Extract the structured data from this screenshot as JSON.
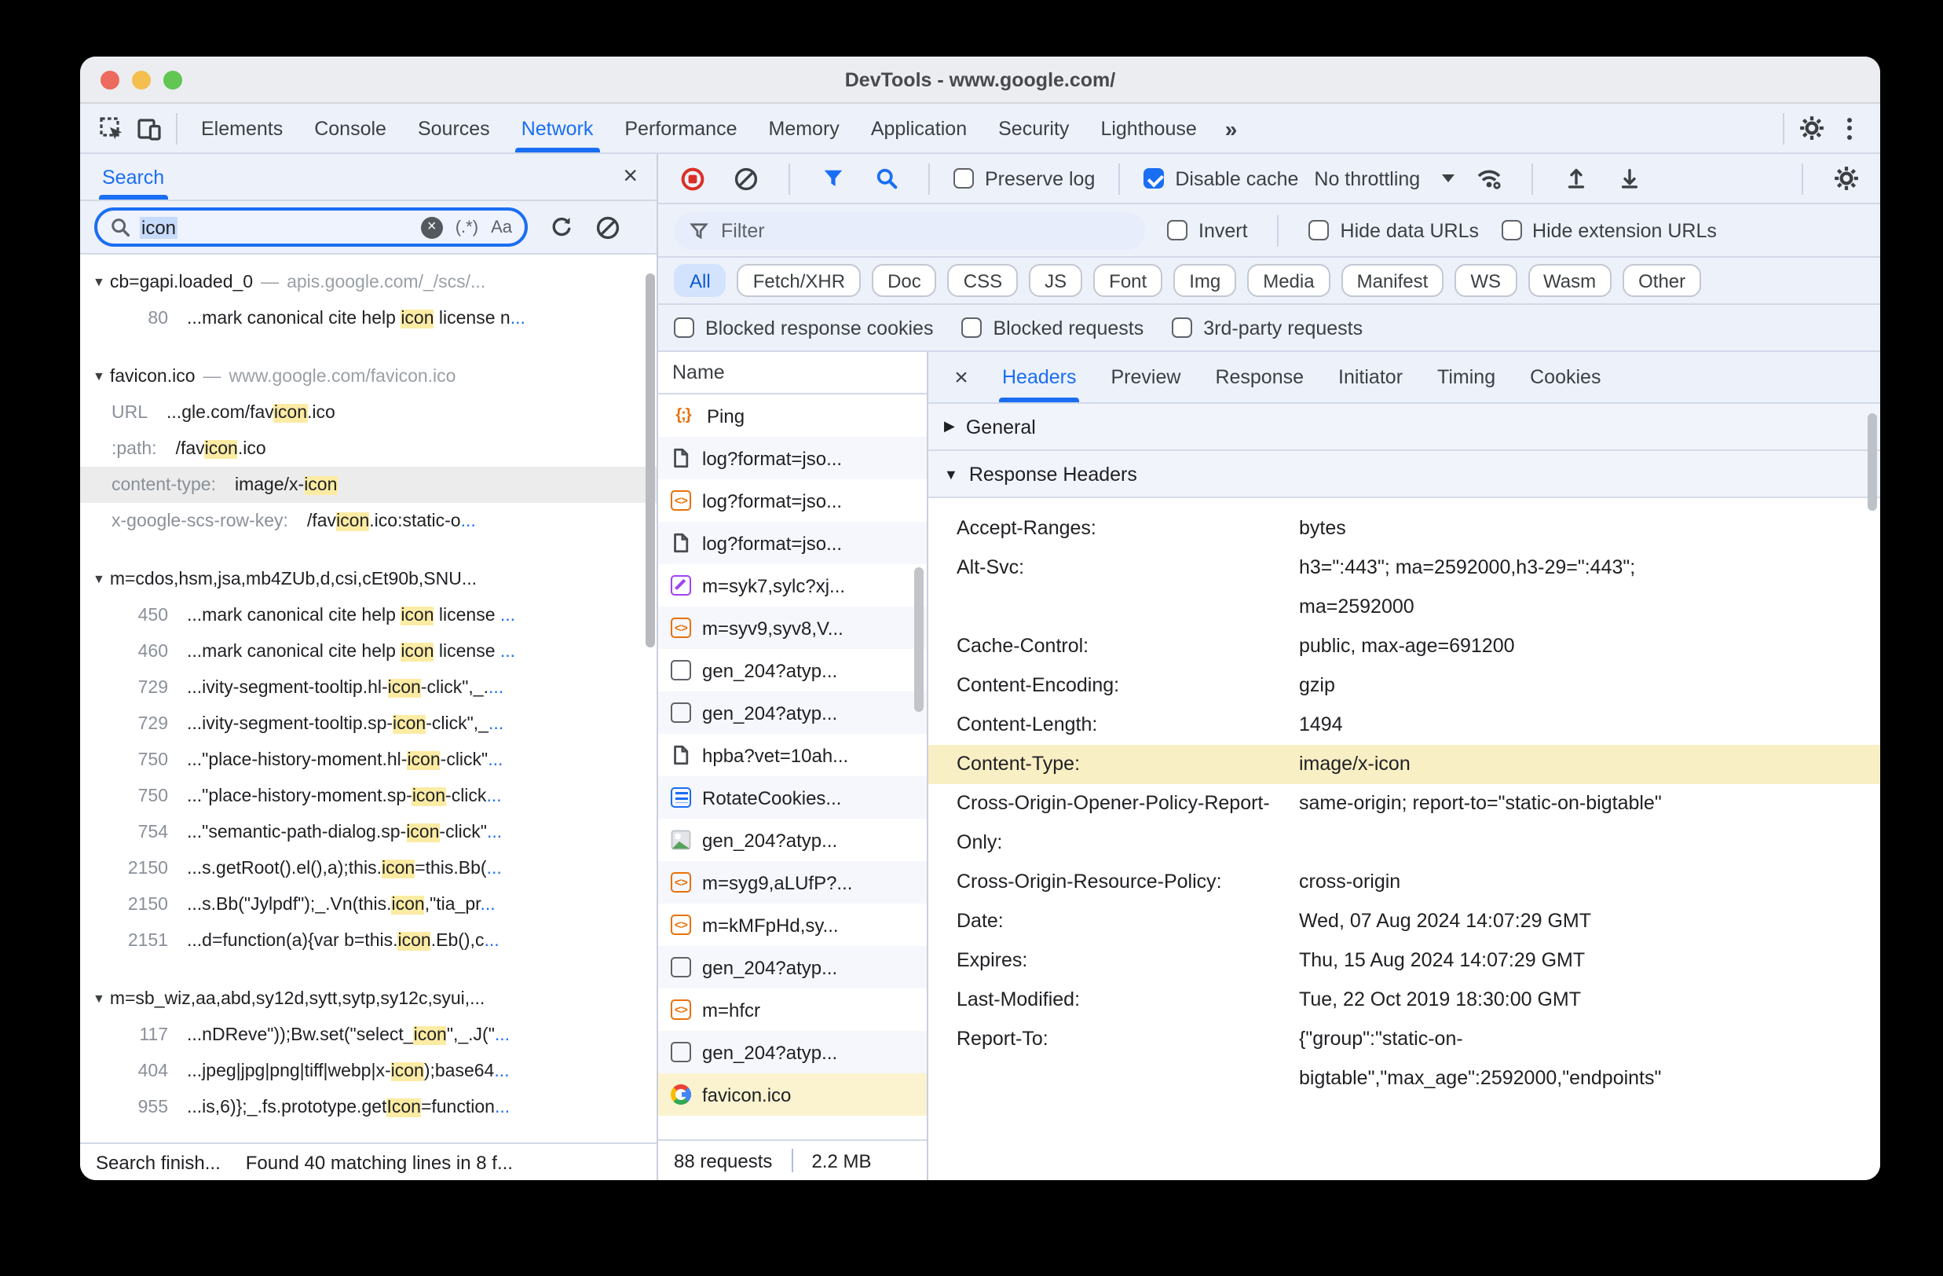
{
  "colors": {
    "accent_blue": "#1a6ef3",
    "highlight_yellow": "#fceba3",
    "record_red": "#d93025",
    "selected_request_yellow": "#fbf3cf"
  },
  "window": {
    "title": "DevTools - www.google.com/"
  },
  "tabs_bar": {
    "tabs": [
      "Elements",
      "Console",
      "Sources",
      "Network",
      "Performance",
      "Memory",
      "Application",
      "Security",
      "Lighthouse"
    ],
    "selected": "Network",
    "overflow_label": "»"
  },
  "search_panel": {
    "tab_label": "Search",
    "close_label": "×",
    "query": "icon",
    "regex_label": "(.*)",
    "case_label": "Aa",
    "results": [
      {
        "file": "cb=gapi.loaded_0",
        "url": "apis.google.com/_/scs/...",
        "lines": [
          {
            "label": "80",
            "segs": [
              {
                "t": "...mark canonical cite help "
              },
              {
                "t": "icon",
                "hl": true
              },
              {
                "t": " license n"
              },
              {
                "t": "...",
                "blue": true
              }
            ]
          }
        ]
      },
      {
        "file": "favicon.ico",
        "url": "www.google.com/favicon.ico",
        "lines": [
          {
            "label": "URL",
            "segs": [
              {
                "t": "...gle.com/fav"
              },
              {
                "t": "icon",
                "hl": true
              },
              {
                "t": ".ico"
              }
            ]
          },
          {
            "label": ":path:",
            "segs": [
              {
                "t": "/fav"
              },
              {
                "t": "icon",
                "hl": true
              },
              {
                "t": ".ico"
              }
            ]
          },
          {
            "label": "content-type:",
            "selected": true,
            "segs": [
              {
                "t": "image/x-"
              },
              {
                "t": "icon",
                "hl": true
              }
            ]
          },
          {
            "label": "x-google-scs-row-key:",
            "segs": [
              {
                "t": "/fav"
              },
              {
                "t": "icon",
                "hl": true
              },
              {
                "t": ".ico:static-o"
              },
              {
                "t": "...",
                "blue": true
              }
            ]
          }
        ]
      },
      {
        "file": "m=cdos,hsm,jsa,mb4ZUb,d,csi,cEt90b,SNU...",
        "url": "",
        "lines": [
          {
            "label": "450",
            "segs": [
              {
                "t": "...mark canonical cite help "
              },
              {
                "t": "icon",
                "hl": true
              },
              {
                "t": " license "
              },
              {
                "t": "...",
                "blue": true
              }
            ]
          },
          {
            "label": "460",
            "segs": [
              {
                "t": "...mark canonical cite help "
              },
              {
                "t": "icon",
                "hl": true
              },
              {
                "t": " license "
              },
              {
                "t": "...",
                "blue": true
              }
            ]
          },
          {
            "label": "729",
            "segs": [
              {
                "t": "...ivity-segment-tooltip.hl-"
              },
              {
                "t": "icon",
                "hl": true
              },
              {
                "t": "-click\",_."
              },
              {
                "t": "...",
                "blue": true
              }
            ]
          },
          {
            "label": "729",
            "segs": [
              {
                "t": "...ivity-segment-tooltip.sp-"
              },
              {
                "t": "icon",
                "hl": true
              },
              {
                "t": "-click\",_"
              },
              {
                "t": "...",
                "blue": true
              }
            ]
          },
          {
            "label": "750",
            "segs": [
              {
                "t": "...\"place-history-moment.hl-"
              },
              {
                "t": "icon",
                "hl": true
              },
              {
                "t": "-click\""
              },
              {
                "t": "...",
                "blue": true
              }
            ]
          },
          {
            "label": "750",
            "segs": [
              {
                "t": "...\"place-history-moment.sp-"
              },
              {
                "t": "icon",
                "hl": true
              },
              {
                "t": "-click"
              },
              {
                "t": "...",
                "blue": true
              }
            ]
          },
          {
            "label": "754",
            "segs": [
              {
                "t": "...\"semantic-path-dialog.sp-"
              },
              {
                "t": "icon",
                "hl": true
              },
              {
                "t": "-click\""
              },
              {
                "t": "...",
                "blue": true
              }
            ]
          },
          {
            "label": "2150",
            "segs": [
              {
                "t": "...s.getRoot().el(),a);this."
              },
              {
                "t": "icon",
                "hl": true
              },
              {
                "t": "=this.Bb("
              },
              {
                "t": "...",
                "blue": true
              }
            ]
          },
          {
            "label": "2150",
            "segs": [
              {
                "t": "...s.Bb(\"Jylpdf\");_.Vn(this."
              },
              {
                "t": "icon",
                "hl": true
              },
              {
                "t": ",\"tia_pr"
              },
              {
                "t": "...",
                "blue": true
              }
            ]
          },
          {
            "label": "2151",
            "segs": [
              {
                "t": "...d=function(a){var b=this."
              },
              {
                "t": "icon",
                "hl": true
              },
              {
                "t": ".Eb(),c"
              },
              {
                "t": "...",
                "blue": true
              }
            ]
          }
        ]
      },
      {
        "file": "m=sb_wiz,aa,abd,sy12d,sytt,sytp,sy12c,syui,...",
        "url": "",
        "lines": [
          {
            "label": "117",
            "segs": [
              {
                "t": "...nDReve\"));Bw.set(\"select_"
              },
              {
                "t": "icon",
                "hl": true
              },
              {
                "t": "\",_.J(\""
              },
              {
                "t": "...",
                "blue": true
              }
            ]
          },
          {
            "label": "404",
            "segs": [
              {
                "t": "...jpeg|jpg|png|tiff|webp|x-"
              },
              {
                "t": "icon",
                "hl": true
              },
              {
                "t": ");base64"
              },
              {
                "t": "...",
                "blue": true
              }
            ]
          },
          {
            "label": "955",
            "segs": [
              {
                "t": "...is,6)};_.fs.prototype.get"
              },
              {
                "t": "Icon",
                "hl": true
              },
              {
                "t": "=function"
              },
              {
                "t": "...",
                "blue": true
              }
            ]
          }
        ]
      }
    ],
    "status": {
      "left": "Search finish...",
      "right": "Found 40 matching lines in 8 f..."
    }
  },
  "network_toolbar": {
    "preserve_log": "Preserve log",
    "disable_cache": "Disable cache",
    "throttling": "No throttling"
  },
  "filter_bar": {
    "placeholder": "Filter",
    "invert": "Invert",
    "hide_data_urls": "Hide data URLs",
    "hide_extension_urls": "Hide extension URLs"
  },
  "type_filters": {
    "chips": [
      "All",
      "Fetch/XHR",
      "Doc",
      "CSS",
      "JS",
      "Font",
      "Img",
      "Media",
      "Manifest",
      "WS",
      "Wasm",
      "Other"
    ],
    "selected": "All"
  },
  "blocked_bar": {
    "blocked_response_cookies": "Blocked response cookies",
    "blocked_requests": "Blocked requests",
    "third_party": "3rd-party requests"
  },
  "requests": {
    "name_header": "Name",
    "rows": [
      {
        "icon": "ping",
        "label": "Ping"
      },
      {
        "icon": "doc",
        "label": "log?format=jso..."
      },
      {
        "icon": "code",
        "label": "log?format=jso..."
      },
      {
        "icon": "doc",
        "label": "log?format=jso..."
      },
      {
        "icon": "wand",
        "label": "m=syk7,sylc?xj..."
      },
      {
        "icon": "code",
        "label": "m=syv9,syv8,V..."
      },
      {
        "icon": "plain",
        "label": "gen_204?atyp..."
      },
      {
        "icon": "plain",
        "label": "gen_204?atyp..."
      },
      {
        "icon": "doc",
        "label": "hpba?vet=10ah..."
      },
      {
        "icon": "lines",
        "label": "RotateCookies..."
      },
      {
        "icon": "image",
        "label": "gen_204?atyp..."
      },
      {
        "icon": "code",
        "label": "m=syg9,aLUfP?..."
      },
      {
        "icon": "code",
        "label": "m=kMFpHd,sy..."
      },
      {
        "icon": "plain",
        "label": "gen_204?atyp..."
      },
      {
        "icon": "code",
        "label": "m=hfcr"
      },
      {
        "icon": "plain",
        "label": "gen_204?atyp..."
      },
      {
        "icon": "google",
        "label": "favicon.ico",
        "selected": true
      }
    ],
    "status": {
      "count": "88 requests",
      "size": "2.2 MB"
    }
  },
  "details": {
    "close_label": "×",
    "tabs": [
      "Headers",
      "Preview",
      "Response",
      "Initiator",
      "Timing",
      "Cookies"
    ],
    "selected": "Headers",
    "sections": {
      "general": "General",
      "response_headers": "Response Headers"
    },
    "headers": [
      {
        "name": "Accept-Ranges:",
        "value": "bytes"
      },
      {
        "name": "Alt-Svc:",
        "value": "h3=\":443\"; ma=2592000,h3-29=\":443\"; ma=2592000"
      },
      {
        "name": "Cache-Control:",
        "value": "public, max-age=691200"
      },
      {
        "name": "Content-Encoding:",
        "value": "gzip"
      },
      {
        "name": "Content-Length:",
        "value": "1494"
      },
      {
        "name": "Content-Type:",
        "value": "image/x-icon",
        "highlight": true
      },
      {
        "name": "Cross-Origin-Opener-Policy-Report-Only:",
        "value": "same-origin; report-to=\"static-on-bigtable\""
      },
      {
        "name": "Cross-Origin-Resource-Policy:",
        "value": "cross-origin"
      },
      {
        "name": "Date:",
        "value": "Wed, 07 Aug 2024 14:07:29 GMT"
      },
      {
        "name": "Expires:",
        "value": "Thu, 15 Aug 2024 14:07:29 GMT"
      },
      {
        "name": "Last-Modified:",
        "value": "Tue, 22 Oct 2019 18:30:00 GMT"
      },
      {
        "name": "Report-To:",
        "value": "{\"group\":\"static-on-bigtable\",\"max_age\":2592000,\"endpoints\""
      }
    ]
  }
}
